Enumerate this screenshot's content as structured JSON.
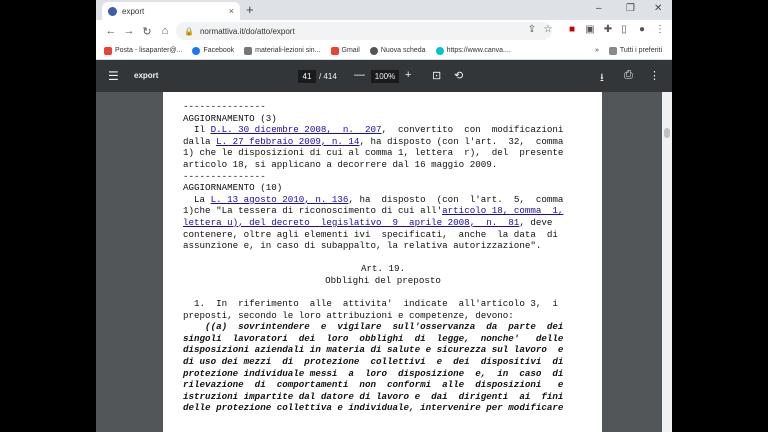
{
  "browser": {
    "tab_title": "export",
    "tab_close": "×",
    "new_tab": "+",
    "url": "normattiva.it/do/atto/export",
    "window_controls": [
      "–",
      "❐",
      "✕"
    ]
  },
  "bookmarks": [
    {
      "label": "Posta - lisapanter@...",
      "color": "#4285f4"
    },
    {
      "label": "Facebook",
      "color": "#1877f2"
    },
    {
      "label": "materiali-lezioni sin...",
      "color": "#555"
    },
    {
      "label": "Gmail",
      "color": "#ea4335"
    },
    {
      "label": "Nuova scheda",
      "color": "#555"
    },
    {
      "label": "https://www.canva....",
      "color": "#00c4cc"
    }
  ],
  "bookmarks_more": "»",
  "bookmarks_folder": "Tutti i preferiti",
  "pdf": {
    "title": "export",
    "page_current": "41",
    "page_total": "/ 414",
    "zoom": "100%",
    "minus": "—",
    "plus": "+"
  },
  "content": {
    "rule1": "---------------",
    "agg3": "AGGIORNAMENTO (3)",
    "agg3_l1a": "  Il ",
    "agg3_link1": "D.L. 30 dicembre 2008,  n.  207",
    "agg3_l1b": ",  convertito  con  modificazioni",
    "agg3_l2a": "dalla ",
    "agg3_link2": "L. 27 febbraio 2009, n. 14",
    "agg3_l2b": ", ha disposto (con l'art.  32,  comma",
    "agg3_l3": "1) che le disposizioni di cui al comma 1, lettera  r),  del  presente",
    "agg3_l4": "articolo 18, si applicano a decorrere dal 16 maggio 2009.",
    "rule2": "---------------",
    "agg10": "AGGIORNAMENTO (10)",
    "agg10_l1a": "  La ",
    "agg10_link1": "L. 13 agosto 2010, n. 136",
    "agg10_l1b": ", ha  disposto  (con  l'art.  5,  comma",
    "agg10_l2a": "1)che \"La tessera di riconoscimento di cui all'",
    "agg10_link2a": "articolo 18, comma  1,",
    "agg10_link2b": "lettera u), del decreto  legislativo  9  aprile 2008,  n.  81",
    "agg10_l3b": ", deve",
    "agg10_l4": "contenere, oltre agli elementi ivi  specificati,  anche  la data  di",
    "agg10_l5": "assunzione e, in caso di subappalto, la relativa autorizzazione\".",
    "art_title": "Art. 19.",
    "art_subtitle": "Obblighi del preposto",
    "p1": "  1.  In  riferimento  alle  attivita'  indicate  all'articolo 3,  i",
    "p2": "preposti, secondo le loro attribuzioni e competenze, devono:",
    "b1": "    ((a)  sovrintendere  e  vigilare  sull'osservanza  da  parte  dei",
    "b2": "singoli  lavoratori  dei  loro  obblighi  di  legge,  nonche'   delle",
    "b3": "disposizioni aziendali in materia di salute e sicurezza sul lavoro  e",
    "b4": "di uso dei mezzi  di  protezione  collettivi  e  dei  dispositivi  di",
    "b5": "protezione individuale messi  a  loro  disposizione  e,  in  caso  di",
    "b6": "rilevazione  di  comportamenti  non  conformi  alle  disposizioni   e",
    "b7": "istruzioni impartite dal datore di lavoro e  dai  dirigenti  ai  fini",
    "b8": "delle protezione collettiva e individuale, intervenire per modificare"
  }
}
